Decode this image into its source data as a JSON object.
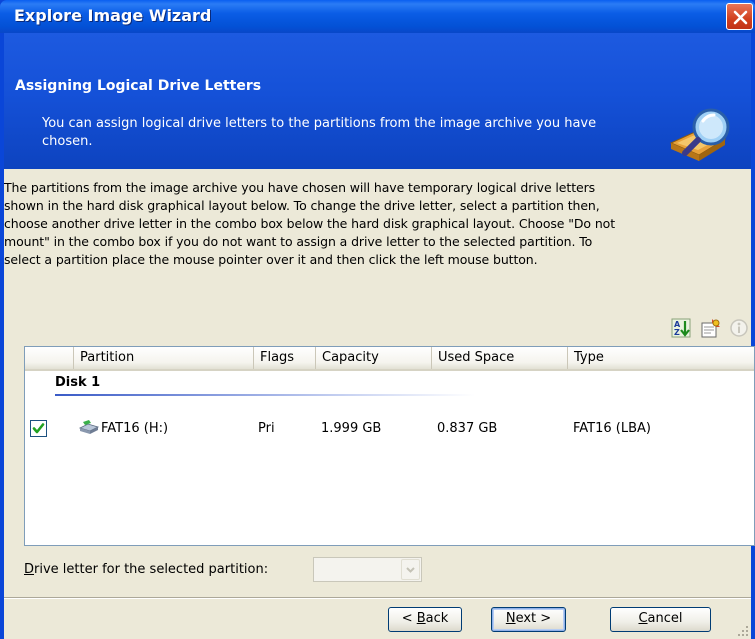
{
  "window": {
    "title": "Explore Image Wizard"
  },
  "header": {
    "title": "Assigning Logical Drive Letters",
    "description": "You can assign logical drive letters to the partitions from the image archive you have chosen."
  },
  "intro": {
    "lines": [
      "The partitions from the image archive you have chosen will have temporary logical drive letters",
      "shown in the hard disk graphical layout below. To change the drive letter, select a partition then,",
      "choose another drive letter in the combo box below the hard disk graphical layout. Choose \"Do not",
      "mount\" in the combo box if you do not want to assign a drive letter to the selected partition. To",
      "select a partition place the mouse pointer over it and then click the left mouse button."
    ]
  },
  "toolbar": {
    "icons": [
      "sort-icon",
      "properties-icon",
      "info-icon"
    ]
  },
  "table": {
    "columns": [
      "Partition",
      "Flags",
      "Capacity",
      "Used Space",
      "Type"
    ],
    "disk_label": "Disk 1",
    "rows": [
      {
        "checked": true,
        "partition": "FAT16 (H:)",
        "flags": "Pri",
        "capacity": "1.999 GB",
        "used_space": "0.837 GB",
        "type": "FAT16 (LBA)"
      }
    ]
  },
  "drive_letter": {
    "label_mnemonic": "D",
    "label_rest": "rive letter for the selected partition:",
    "value": ""
  },
  "buttons": {
    "back_prefix": "< ",
    "back_mnemonic": "B",
    "back_rest": "ack",
    "next_mnemonic": "N",
    "next_rest": "ext >",
    "cancel_mnemonic": "C",
    "cancel_rest": "ancel"
  },
  "colors": {
    "titlebar": "#0a5ff0",
    "header": "#1551d8",
    "dialog_bg": "#ece9d8",
    "check_green": "#21a121"
  }
}
